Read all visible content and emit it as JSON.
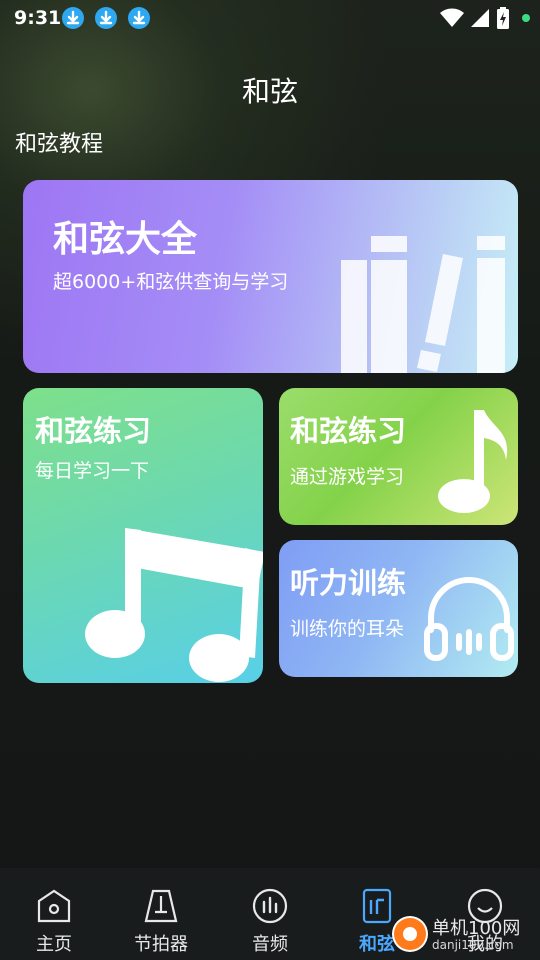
{
  "status_bar": {
    "time": "9:31",
    "icons": [
      "download-icon",
      "download-icon",
      "download-icon",
      "wifi-icon",
      "signal-icon",
      "battery-charging-icon",
      "notification-dot-icon"
    ],
    "dot_color": "#3ddc84"
  },
  "header": {
    "title": "和弦"
  },
  "section": {
    "title": "和弦教程"
  },
  "cards": {
    "chord_library": {
      "title": "和弦大全",
      "subtitle": "超6000+和弦供查询与学习",
      "icon": "books-icon"
    },
    "chord_practice_daily": {
      "title": "和弦练习",
      "subtitle": "每日学习一下",
      "icon": "music-notes-icon"
    },
    "chord_practice_game": {
      "title": "和弦练习",
      "subtitle": "通过游戏学习",
      "icon": "music-note-icon"
    },
    "ear_training": {
      "title": "听力训练",
      "subtitle": "训练你的耳朵",
      "icon": "headphones-icon"
    }
  },
  "tab_bar": {
    "tabs": [
      {
        "label": "主页",
        "icon": "home-icon"
      },
      {
        "label": "节拍器",
        "icon": "metronome-icon"
      },
      {
        "label": "音频",
        "icon": "audio-icon"
      },
      {
        "label": "和弦",
        "icon": "chord-icon",
        "active": true
      },
      {
        "label": "我的",
        "icon": "profile-icon"
      }
    ],
    "active_color": "#4aa8ff"
  },
  "watermark": {
    "text": "单机100网",
    "url": "danji100.com"
  }
}
